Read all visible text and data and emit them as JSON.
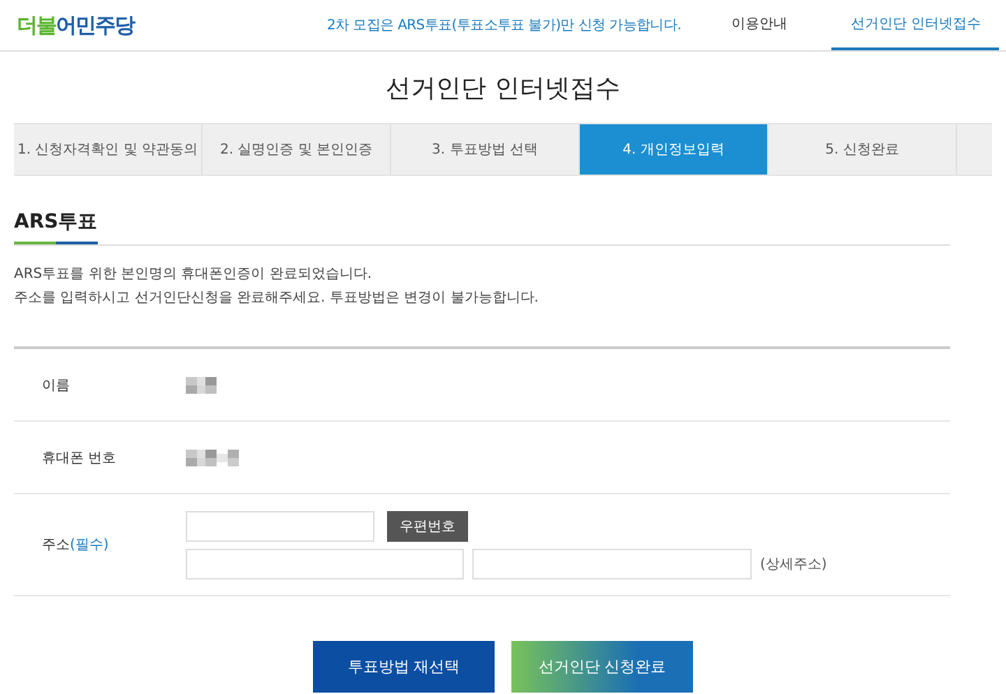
{
  "header": {
    "logo": [
      {
        "text": "더불",
        "color": "#5cb531"
      },
      {
        "text": "어민주당",
        "color": "#1f5fa8"
      }
    ],
    "notice": "2차 모집은 ARS투표(투표소투표 불가)만 신청 가능합니다.",
    "nav": [
      {
        "label": "이용안내",
        "selected": false
      },
      {
        "label": "선거인단 인터넷접수",
        "selected": true
      }
    ]
  },
  "page_title": "선거인단 인터넷접수",
  "steps": [
    {
      "label": "1. 신청자격확인 및 약관동의",
      "selected": false
    },
    {
      "label": "2. 실명인증 및 본인인증",
      "selected": false
    },
    {
      "label": "3. 투표방법 선택",
      "selected": false
    },
    {
      "label": "4. 개인정보입력",
      "selected": true
    },
    {
      "label": "5. 신청완료",
      "selected": false
    }
  ],
  "section": {
    "title": "ARS투표",
    "lines": [
      "ARS투표를 위한 본인명의 휴대폰인증이 완료되었습니다.",
      "주소를 입력하시고 선거인단신청을 완료해주세요. 투표방법은 변경이 불가능합니다."
    ]
  },
  "form": {
    "rows": [
      {
        "kind": "masked",
        "label": "이름"
      },
      {
        "kind": "masked",
        "label": "휴대폰 번호"
      },
      {
        "kind": "address",
        "label": "주소",
        "required": "(필수)",
        "zip_button": "우편번호",
        "detail_hint": "(상세주소)"
      }
    ]
  },
  "buttons": [
    {
      "label": "투표방법 재선택",
      "kind": "dark"
    },
    {
      "label": "선거인단 신청완료",
      "kind": "gradient"
    }
  ]
}
